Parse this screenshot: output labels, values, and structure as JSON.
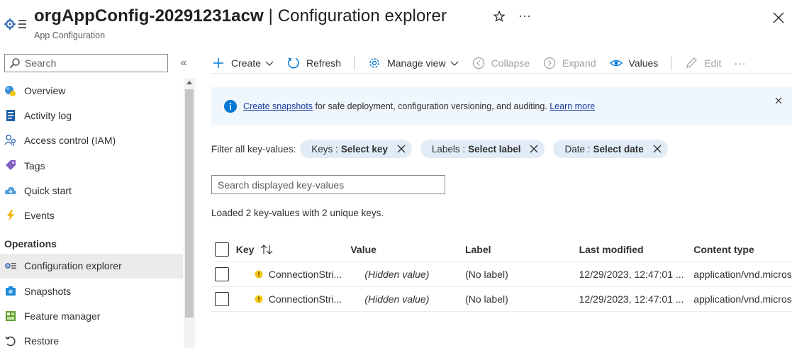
{
  "header": {
    "resource_name": "orgAppConfig-20291231acw",
    "separator": " | ",
    "page_title": "Configuration explorer",
    "subtitle": "App Configuration"
  },
  "sidebar": {
    "search_placeholder": "Search",
    "collapse_glyph": "«",
    "items": [
      {
        "label": "Overview",
        "icon": "overview-icon"
      },
      {
        "label": "Activity log",
        "icon": "activity-log-icon"
      },
      {
        "label": "Access control (IAM)",
        "icon": "iam-icon"
      },
      {
        "label": "Tags",
        "icon": "tag-icon"
      },
      {
        "label": "Quick start",
        "icon": "cloud-icon"
      },
      {
        "label": "Events",
        "icon": "lightning-icon"
      }
    ],
    "section_operations": "Operations",
    "operations_items": [
      {
        "label": "Configuration explorer",
        "icon": "config-explorer-icon",
        "active": true
      },
      {
        "label": "Snapshots",
        "icon": "snapshot-icon"
      },
      {
        "label": "Feature manager",
        "icon": "feature-manager-icon"
      },
      {
        "label": "Restore",
        "icon": "restore-icon"
      }
    ]
  },
  "toolbar": {
    "create": "Create",
    "refresh": "Refresh",
    "manage_view": "Manage view",
    "collapse": "Collapse",
    "expand": "Expand",
    "values": "Values",
    "edit": "Edit",
    "more": "···"
  },
  "banner": {
    "link1": "Create snapshots",
    "text": " for safe deployment, configuration versioning, and auditing. ",
    "link2": "Learn more"
  },
  "filters": {
    "label": "Filter all key-values:",
    "pills": [
      {
        "name": "Keys :",
        "value": "Select key"
      },
      {
        "name": "Labels :",
        "value": "Select label"
      },
      {
        "name": "Date :",
        "value": "Select date"
      }
    ]
  },
  "kv_search_placeholder": "Search displayed key-values",
  "loaded_text": "Loaded 2 key-values with 2 unique keys.",
  "table": {
    "columns": [
      "Key",
      "Value",
      "Label",
      "Last modified",
      "Content type"
    ],
    "rows": [
      {
        "key": "ConnectionStri...",
        "value": "(Hidden value)",
        "label": "(No label)",
        "modified": "12/29/2023, 12:47:01 ...",
        "content_type": "application/vnd.microsoft"
      },
      {
        "key": "ConnectionStri...",
        "value": "(Hidden value)",
        "label": "(No label)",
        "modified": "12/29/2023, 12:47:01 ...",
        "content_type": "application/vnd.microsoft"
      }
    ]
  },
  "colors": {
    "accent": "#0078d4",
    "banner_bg": "#eff6fc",
    "pill_bg": "#e1ecf7",
    "active_nav": "#edebe9"
  }
}
